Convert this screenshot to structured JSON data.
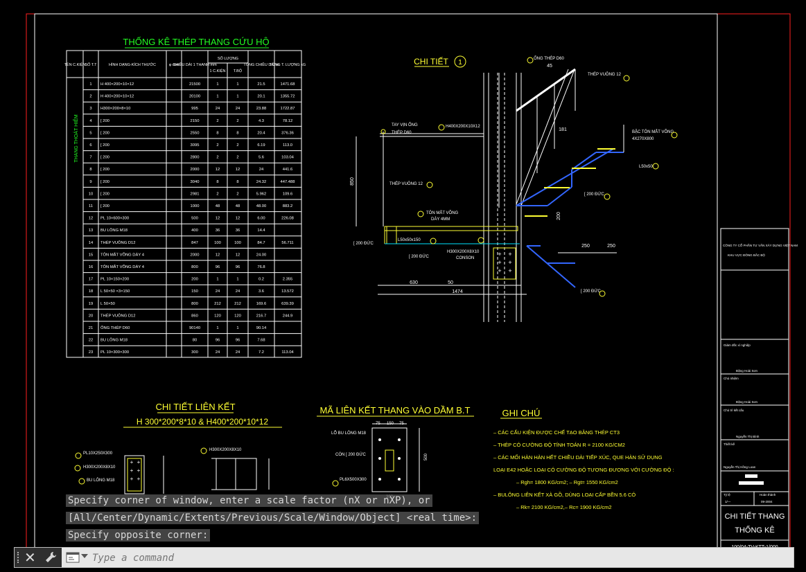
{
  "drawing": {
    "table_title": "THỐNG KÊ THÉP THANG CỨU HỘ",
    "table_headers": [
      "TÊN C.KIỆN",
      "SỐ T.T",
      "HÌNH DẠNG-KÍCH THƯỚC",
      "φ mm",
      "CHIỀU DÀI 1 THANH mm",
      "SỐ LƯỢNG",
      "1 C.KIỆN",
      "T.BỘ",
      "TỔNG CHIỀU DÀI m",
      "TỔNG T. LƯỢNG kG"
    ],
    "member_name": "THANG THOÁT HIỂM",
    "rows": [
      [
        "1",
        "H 400×200×10×12",
        "",
        "21500",
        "1",
        "1",
        "21.5",
        "1471.68"
      ],
      [
        "2",
        "H 400×200×10×12",
        "",
        "20100",
        "1",
        "1",
        "20.1",
        "1355.72"
      ],
      [
        "3",
        "H300×200×8×10",
        "",
        "995",
        "24",
        "24",
        "23.88",
        "1722.87"
      ],
      [
        "4",
        "[ 200",
        "",
        "2150",
        "2",
        "2",
        "4.3",
        "78.12"
      ],
      [
        "5",
        "[ 200",
        "",
        "2550",
        "8",
        "8",
        "20.4",
        "376.36"
      ],
      [
        "6",
        "[ 200",
        "",
        "3095",
        "2",
        "2",
        "6.19",
        "113.0"
      ],
      [
        "7",
        "[ 200",
        "",
        "2800",
        "2",
        "2",
        "5.6",
        "103.04"
      ],
      [
        "8",
        "[ 200",
        "",
        "2000",
        "12",
        "12",
        "24",
        "441.6"
      ],
      [
        "9",
        "[ 200",
        "",
        "3040",
        "8",
        "8",
        "24.32",
        "447.488"
      ],
      [
        "10",
        "[ 200",
        "",
        "2981",
        "2",
        "2",
        "5.962",
        "109.6"
      ],
      [
        "11",
        "[ 200",
        "",
        "1000",
        "48",
        "48",
        "48.00",
        "883.2"
      ],
      [
        "12",
        "PL 10×600×300",
        "",
        "500",
        "12",
        "12",
        "6.00",
        "226.08"
      ],
      [
        "13",
        "BU LÔNG M18",
        "",
        "400",
        "36",
        "36",
        "14.4",
        ""
      ],
      [
        "14",
        "THÉP VUÔNG D12",
        "",
        "847",
        "100",
        "100",
        "84.7",
        "56.711"
      ],
      [
        "15",
        "TÔN MẮT VÕNG DÀY 4",
        "",
        "2000",
        "12",
        "12",
        "24.00",
        ""
      ],
      [
        "16",
        "TÔN MẮT VÕNG DÀY 4",
        "",
        "800",
        "96",
        "96",
        "76.8",
        ""
      ],
      [
        "17",
        "PL 10×150×200",
        "",
        "200",
        "1",
        "1",
        "0.2",
        "2.355"
      ],
      [
        "18",
        "L 50×50 ×3×150",
        "",
        "150",
        "24",
        "24",
        "3.6",
        "13.572"
      ],
      [
        "19",
        "L 50×50",
        "",
        "800",
        "212",
        "212",
        "169.6",
        "639.39"
      ],
      [
        "20",
        "THÉP VUÔNG D12",
        "",
        "860",
        "120",
        "120",
        "216.7",
        "244.9"
      ],
      [
        "21",
        "ỐNG THÉP D60",
        "",
        "90140",
        "1",
        "1",
        "90.14",
        ""
      ],
      [
        "22",
        "BU LÔNG M18",
        "",
        "80",
        "96",
        "96",
        "7.68",
        ""
      ],
      [
        "23",
        "PL 10×300×300",
        "",
        "300",
        "24",
        "24",
        "7.2",
        "113.04"
      ]
    ],
    "detail1_title": "CHI TIẾT",
    "detail1_num": "1",
    "labels": {
      "ong_thep": "ỐNG THÉP D60",
      "thep_vuong12": "THÉP VUÔNG 12",
      "tay_vin": "TAY VỊN ỐNG",
      "thep_d60": "THÉP D60",
      "h400": "H400X200X10X12",
      "bac_ton": "BẬC TÔN MẮT VÕNG",
      "bac_ton_dim": "4X270X800",
      "l50": "L50x50",
      "c200duc": "[ 200 ĐỨC",
      "ton_mat_vong": "TÔN MẮT VÕNG",
      "day4": "DÀY 4MM",
      "h300": "H300X200X8X10",
      "conson": "CONSON",
      "l50b": "L50x50x150"
    },
    "dims": {
      "d45": "45",
      "d181": "181",
      "d250a": "250",
      "d250b": "250",
      "d850": "850",
      "d630": "630",
      "d1474": "1474",
      "d200": "200",
      "d50": "50"
    },
    "lienket_title1": "CHI TIẾT LIÊN KẾT",
    "lienket_title2": "H 300*200*8*10 & H400*200*10*12",
    "lienket_labels": [
      "PL10X250X300",
      "H300X200X8X10",
      "BU LÔNG M18",
      "H300X200X8X10",
      "PL12X200X300"
    ],
    "ma_lienket_title": "MÃ LIÊN KẾT THANG VÀO DẦM B.T",
    "ma_labels": [
      "LỖ BU LÔNG M18",
      "CÓN [ 200 ĐỨC",
      "PL6X500X300"
    ],
    "ma_dims": [
      "75",
      "150",
      "75",
      "500",
      "300"
    ],
    "ghichu_title": "GHI CHÚ",
    "ghichu": [
      "– CÁC CẤU KIỆN ĐƯỢC CHẾ TẠO BẰNG THÉP CT3",
      "– THÉP CÓ CƯỜNG ĐỘ TÍNH TOÁN R = 2100 KG/CM2",
      "– CÁC MỐI HÀN HÀN HẾT CHIỀU DÀI TIẾP XÚC, QUE HÀN SỬ DỤNG",
      "LOẠI E42 HOẶC LOẠI CÓ CƯỜNG ĐỘ TƯƠNG ĐƯƠNG VỚI CƯỜNG ĐỘ :",
      "– Rgh= 1800 KG/cm2; – Rgt= 1550 KG/cm2",
      "– BULÔNG LIÊN KẾT XÀ GỒ, DÙNG LOẠI CẤP BỀN 5.6 CÓ",
      "– Rk= 2100 KG/cm2,– Rc= 1900 KG/cm2"
    ],
    "titleblock": {
      "company": "CÔNG TY CỔ PHẦN TƯ VẤN XÂY DỰNG VIỆT NAM",
      "project": "KHU VỰC ĐÔNG BẮC BỘ",
      "roles": [
        "Giám đốc xí nghiệp",
        "Chủ nhiệm",
        "Chủ trì kết cấu",
        "Thiết kế"
      ],
      "names": [
        "Đặng Hoài Sơn",
        "Đặng Hoài Sơn",
        "Nguyễn Thị Bình",
        "Nguyễn Thị Hồng Loan"
      ],
      "scale_label": "Tỷ lệ",
      "scale": "1/—",
      "done_label": "Hoàn thành",
      "done": "09-2004",
      "sheet_title1": "CHI TIẾT THANG",
      "sheet_title2": "THỐNG KÊ",
      "code": "100/04-TV-KTT-1/000"
    }
  },
  "command_history": [
    "Specify corner of window, enter a scale factor (nX or nXP), or",
    "[All/Center/Dynamic/Extents/Previous/Scale/Window/Object] <real time>:",
    "Specify opposite corner:"
  ],
  "command_input": {
    "placeholder": "Type a command",
    "value": ""
  },
  "colors": {
    "frame": "#ff2020",
    "lines": "#ffffff",
    "green": "#22ff22",
    "yellow": "#ffff33",
    "cyan": "#00e5ff",
    "blue": "#3366ff",
    "magenta": "#ff44ff"
  },
  "icons": [
    "close-icon",
    "wrench-icon",
    "command-prompt-icon",
    "dropdown-caret-icon"
  ]
}
